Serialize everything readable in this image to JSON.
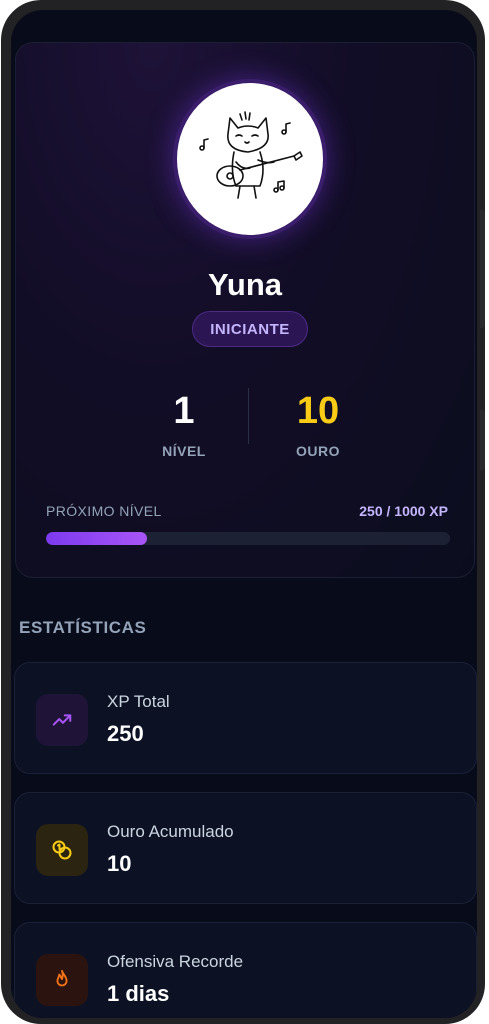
{
  "profile": {
    "username": "Yuna",
    "rank_badge": "INICIANTE",
    "level_value": "1",
    "level_label": "NÍVEL",
    "gold_value": "10",
    "gold_label": "OURO",
    "next_level_label": "PRÓXIMO NÍVEL",
    "xp_text": "250 / 1000 XP",
    "xp_progress": 0.25
  },
  "stats": {
    "section_title": "ESTATÍSTICAS",
    "cards": [
      {
        "label": "XP Total",
        "value": "250",
        "icon": "trending-up-icon"
      },
      {
        "label": "Ouro Acumulado",
        "value": "10",
        "icon": "coins-icon"
      },
      {
        "label": "Ofensiva Recorde",
        "value": "1 dias",
        "icon": "flame-icon"
      }
    ]
  },
  "colors": {
    "accent": "#a855f7",
    "gold": "#facc15",
    "streak": "#f97316",
    "background": "#070b1a"
  }
}
